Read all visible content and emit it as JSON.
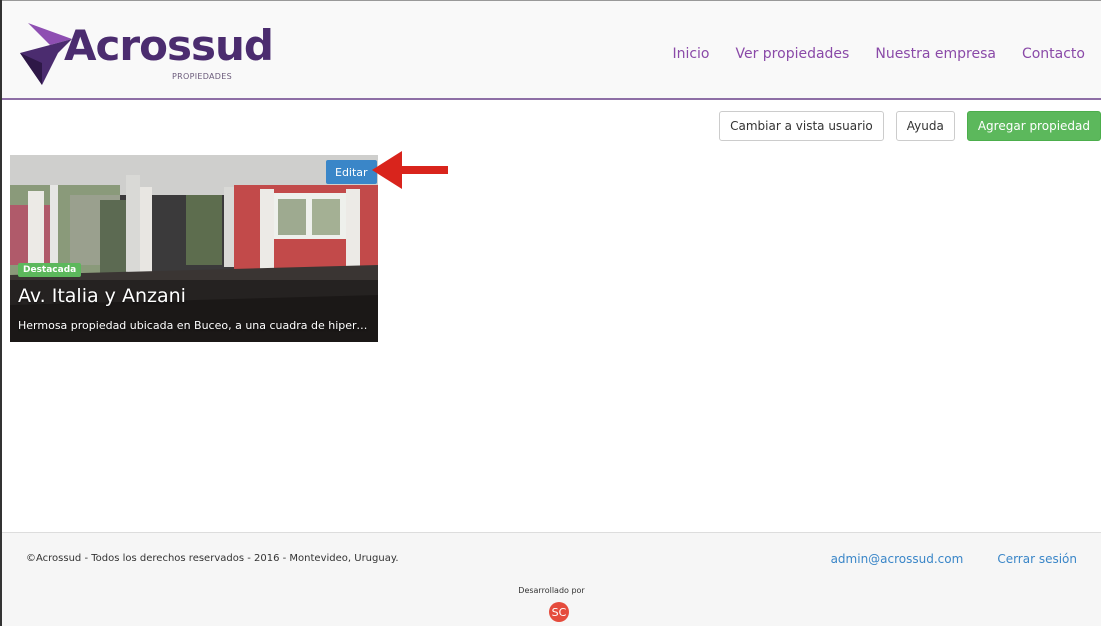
{
  "header": {
    "logo_text": "Acrossud",
    "logo_subtext": "PROPIEDADES",
    "nav": [
      "Inicio",
      "Ver propiedades",
      "Nuestra empresa",
      "Contacto"
    ]
  },
  "actions": {
    "switch_view": "Cambiar a vista usuario",
    "help": "Ayuda",
    "add_property": "Agregar propiedad"
  },
  "property": {
    "edit_label": "Editar",
    "badge": "Destacada",
    "title": "Av. Italia y Anzani",
    "description": "Hermosa propiedad ubicada en Buceo, a una cuadra de hiperm..."
  },
  "footer": {
    "copyright": "©Acrossud - Todos los derechos reservados - 2016 - Montevideo, Uruguay.",
    "user_email": "admin@acrossud.com",
    "logout": "Cerrar sesión",
    "developed_by": "Desarrollado por",
    "dev_logo": "SC"
  },
  "colors": {
    "brand_purple": "#4b2c6f",
    "nav_purple": "#8a4aa8",
    "accent_green": "#5cb85c",
    "accent_blue": "#3a86c8",
    "arrow_red": "#d9241c"
  }
}
